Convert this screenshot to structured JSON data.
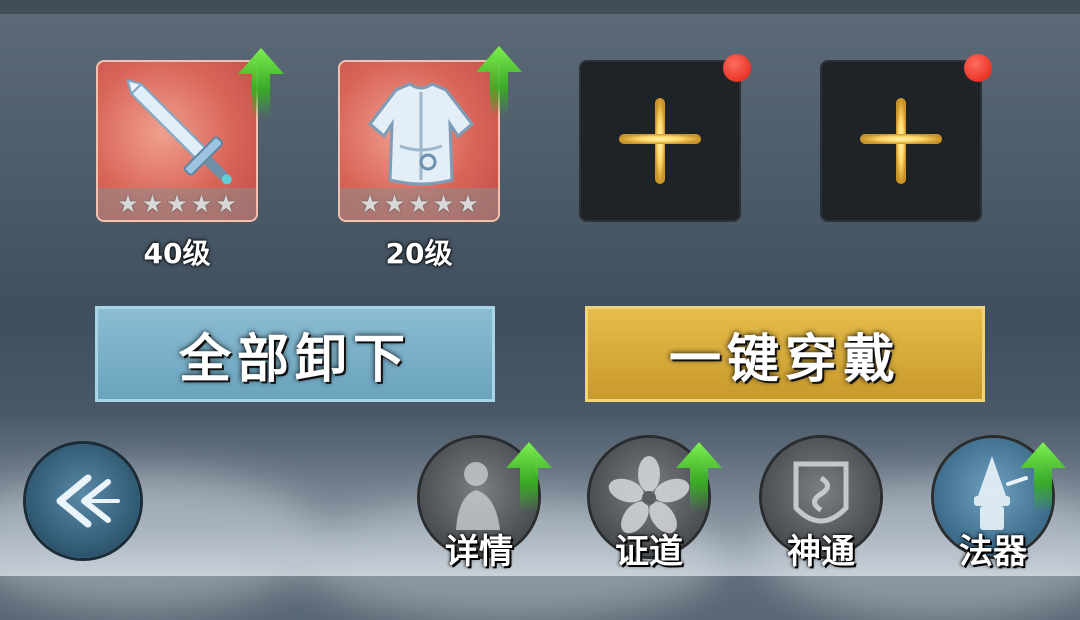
{
  "equipment": [
    {
      "level": "40级",
      "stars": 5,
      "item": "sword-icon",
      "upgrade": true
    },
    {
      "level": "20级",
      "stars": 5,
      "item": "robe-icon",
      "upgrade": true
    },
    {
      "empty": true,
      "notification": true
    },
    {
      "empty": true,
      "notification": true
    }
  ],
  "buttons": {
    "unequip_all": "全部卸下",
    "equip_all": "一键穿戴"
  },
  "nav": [
    {
      "label": "详情",
      "icon": "character-icon",
      "upgrade": true
    },
    {
      "label": "证道",
      "icon": "flower-icon",
      "upgrade": true
    },
    {
      "label": "神通",
      "icon": "talisman-icon",
      "upgrade": false
    },
    {
      "label": "法器",
      "icon": "artifact-icon",
      "upgrade": true
    }
  ],
  "colors": {
    "upgrade_arrow": "#4fc62f",
    "notification_dot": "#e83526",
    "unequip_button": "#7bb0c8",
    "equip_button": "#d8ad3a",
    "plus_glow": "#ffd86a"
  }
}
